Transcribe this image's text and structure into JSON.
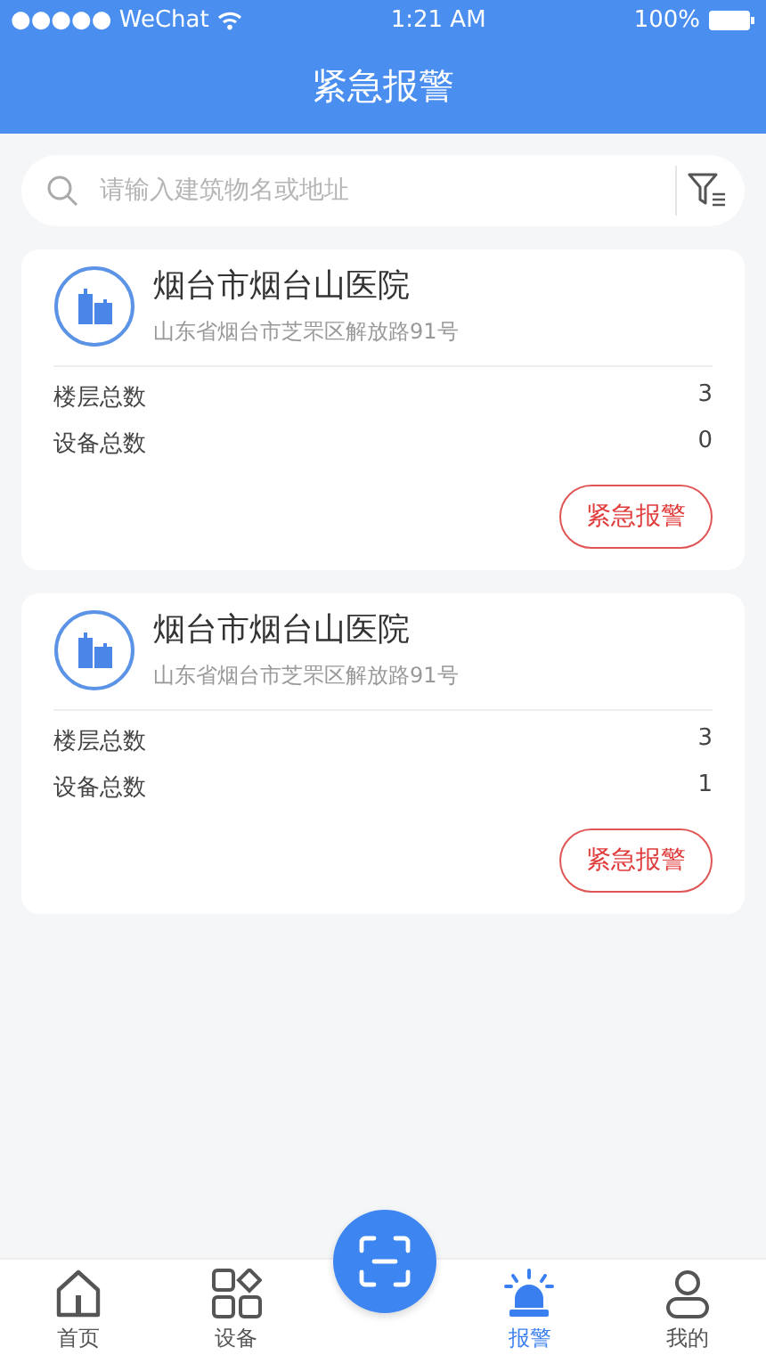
{
  "status_bar": {
    "carrier": "●●●●● WeChat",
    "time": "1:21 AM",
    "battery": "100%"
  },
  "header": {
    "title": "紧急报警"
  },
  "search": {
    "placeholder": "请输入建筑物名或地址"
  },
  "buildings": [
    {
      "name": "烟台市烟台山医院",
      "address": "山东省烟台市芝罘区解放路91号",
      "stats": [
        {
          "label": "楼层总数",
          "value": "3"
        },
        {
          "label": "设备总数",
          "value": "0"
        }
      ],
      "action": "紧急报警"
    },
    {
      "name": "烟台市烟台山医院",
      "address": "山东省烟台市芝罘区解放路91号",
      "stats": [
        {
          "label": "楼层总数",
          "value": "3"
        },
        {
          "label": "设备总数",
          "value": "1"
        }
      ],
      "action": "紧急报警"
    }
  ],
  "tab_bar": [
    {
      "kind": "home",
      "label": "首页",
      "selected": false
    },
    {
      "kind": "grid",
      "label": "设备",
      "selected": false
    },
    {
      "kind": "scan"
    },
    {
      "kind": "alarm",
      "label": "报警",
      "selected": true
    },
    {
      "kind": "user",
      "label": "我的",
      "selected": false
    }
  ]
}
